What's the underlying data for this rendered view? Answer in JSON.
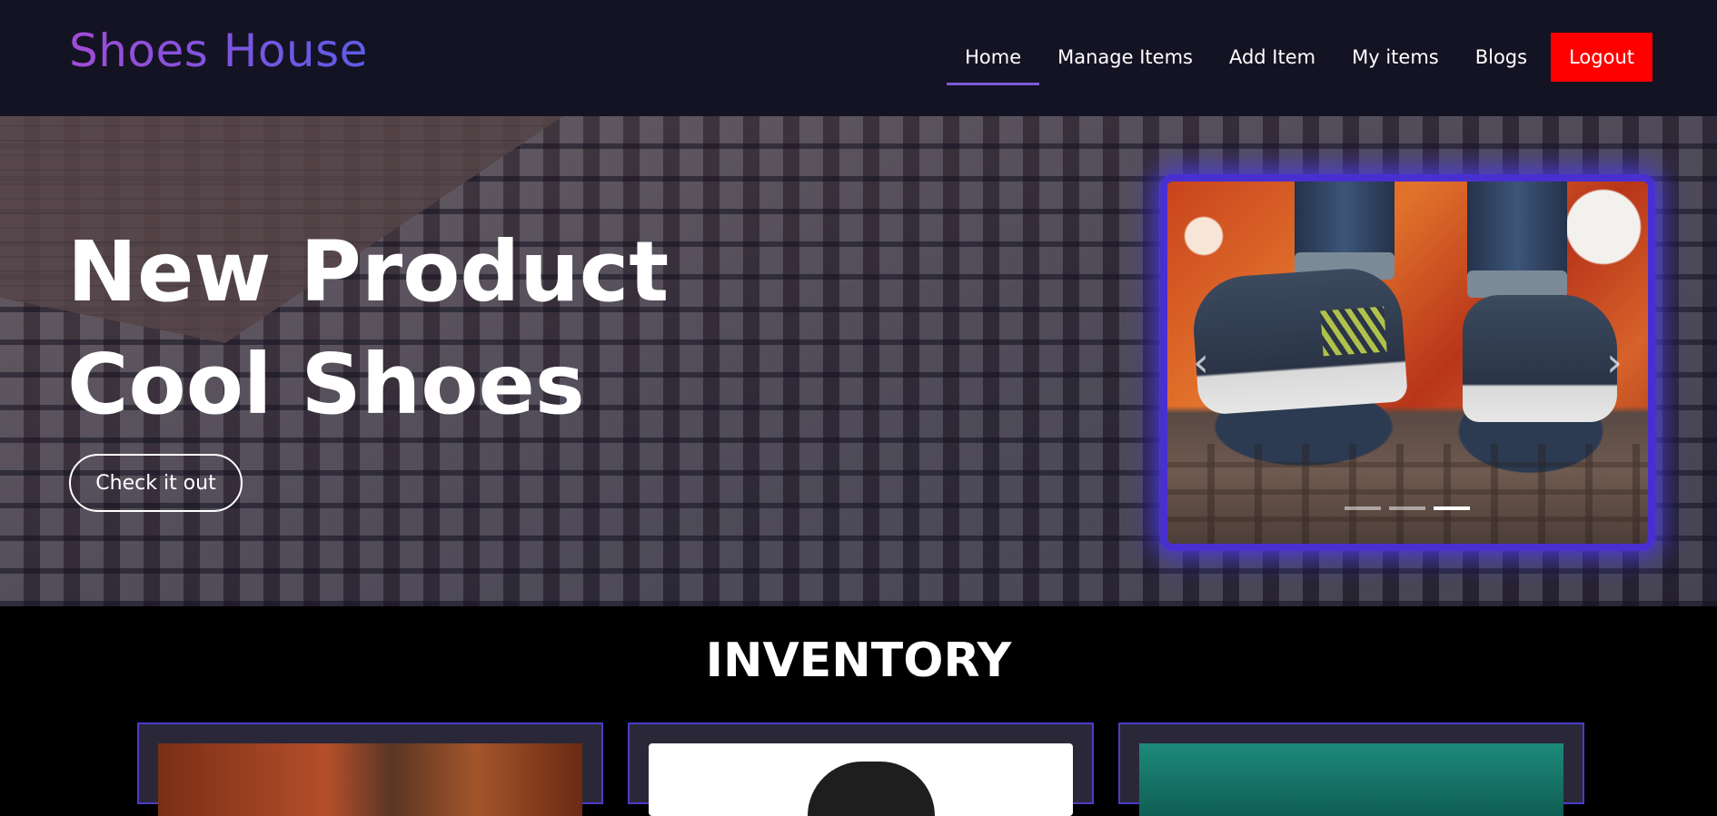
{
  "navbar": {
    "brand": "Shoes House",
    "links": [
      {
        "label": "Home",
        "active": true
      },
      {
        "label": "Manage Items",
        "active": false
      },
      {
        "label": "Add Item",
        "active": false
      },
      {
        "label": "My items",
        "active": false
      },
      {
        "label": "Blogs",
        "active": false
      }
    ],
    "logout_label": "Logout"
  },
  "hero": {
    "title_line1": "New Product",
    "title_line2": "Cool Shoes",
    "cta_label": "Check it out"
  },
  "carousel": {
    "prev_icon": "chevron-left-icon",
    "next_icon": "chevron-right-icon",
    "prev_glyph": "‹",
    "next_glyph": "›",
    "slide_count": 3,
    "active_index": 2
  },
  "inventory": {
    "title": "INVENTORY",
    "cards": [
      {
        "image": "brown-shoes-image"
      },
      {
        "image": "black-shoe-image"
      },
      {
        "image": "teal-shoe-image"
      }
    ]
  },
  "colors": {
    "navbar_bg": "#141323",
    "brand_gradient_start": "#a24bd6",
    "brand_gradient_end": "#5d5ce8",
    "active_underline": "#7b5ad8",
    "logout_bg": "#ff0000",
    "carousel_glow": "#4b3ae0",
    "card_border": "#4b3cc7",
    "inventory_bg": "#000000"
  }
}
